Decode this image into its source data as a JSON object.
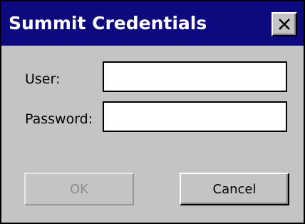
{
  "window": {
    "title": "Summit Credentials",
    "close_label": "×"
  },
  "form": {
    "user_label": "User:",
    "user_value": "",
    "password_label": "Password:",
    "password_value": ""
  },
  "buttons": {
    "ok_label": "OK",
    "ok_enabled": false,
    "cancel_label": "Cancel"
  },
  "colors": {
    "titlebar": "#0c0a7e",
    "dialog_background": "#c6c3c6",
    "disabled_text": "#8e8c8e"
  }
}
